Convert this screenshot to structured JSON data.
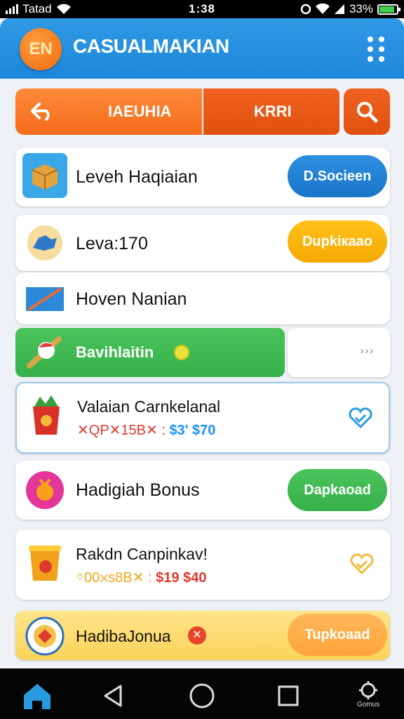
{
  "status_bar": {
    "carrier": "Tatad",
    "time": "1:38",
    "battery": "33%"
  },
  "app_bar": {
    "logo_text": "EN",
    "title": "CASUALMAKIAN"
  },
  "tabs": {
    "primary_label": "IAEUHIA",
    "secondary_label": "KRRI"
  },
  "list": [
    {
      "title": "Leveh Haqiaian",
      "button": "D.Socieen"
    },
    {
      "title": "Leva:170",
      "button": "Dupkiкaao"
    },
    {
      "title": "Hoven Nanian"
    },
    {
      "title": "Bavihlaitin",
      "arrow_label": "›››"
    },
    {
      "title": "Valaian Carnkelanal",
      "price_a": "✕QP✕15B✕ :",
      "price_b": "$3' $70"
    },
    {
      "title": "Hadigiah Bonus",
      "button": "Dapkaoad"
    },
    {
      "title": "Rakdn Canpinkav!",
      "price_a": "ᛜ00✕s8B✕ :",
      "price_b": "$19 $40"
    },
    {
      "title": "HadibaJonua",
      "button": "Tupkoaad"
    }
  ],
  "nav": {
    "settings_label": "Gomus"
  },
  "colors": {
    "primary_blue": "#1e86d8",
    "accent_orange": "#f46c1a",
    "green": "#37b04a",
    "yellow": "#f7b500",
    "price_red": "#e0392e",
    "price_blue": "#1e90ff"
  }
}
